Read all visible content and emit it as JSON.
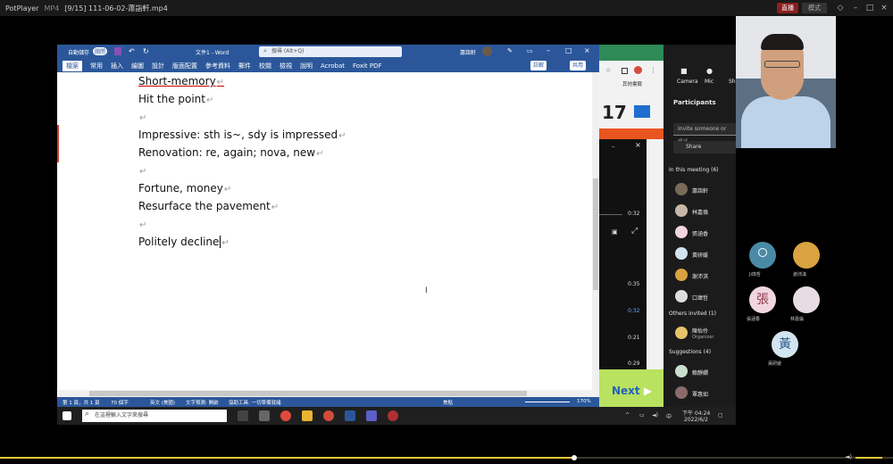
{
  "player": {
    "app_name": "PotPlayer",
    "format": "MP4",
    "file_title": "[9/15] 111-06-02-蕭詣軒.mp4",
    "live_badge": "直播",
    "mode_label": "模式"
  },
  "word": {
    "autosave_label": "自動儲存",
    "autosave_state": "關閉",
    "doc_title": "文件1 - Word",
    "search_placeholder": "搜尋 (Alt+Q)",
    "user_name": "蕭詣軒",
    "tabs": [
      "檔案",
      "常用",
      "插入",
      "繪圖",
      "設計",
      "版面配置",
      "參考資料",
      "郵件",
      "校閱",
      "檢視",
      "說明",
      "Acrobat",
      "Foxit PDF"
    ],
    "comment_btn": "註解",
    "share_btn": "共用",
    "lines": [
      "Short-memory",
      "Hit the point",
      "",
      "Impressive: sth is~, sdy is impressed",
      "Renovation: re, again; nova, new",
      "",
      "Fortune, money",
      "Resurface the pavement",
      "",
      "Politely decline"
    ],
    "status": {
      "page": "第 1 頁，共 1 頁",
      "words": "70 個字",
      "lang": "英文 (美國)",
      "predict": "文字預測: 開啟",
      "accessibility": "協助工具: 一切準備就緒",
      "focus": "焦點",
      "zoom": "170%"
    }
  },
  "taskbar": {
    "search_placeholder": "在這裡輸入文字來搜尋",
    "time": "下午 04:24",
    "date": "2022/6/2"
  },
  "browser": {
    "bookmark": "其他書籤",
    "calendar_number": "17",
    "times": [
      "0:32",
      "0:35",
      "0:32",
      "0:21",
      "0:29"
    ],
    "next_label": "Next"
  },
  "teams": {
    "toolbar": [
      "Camera",
      "Mic",
      "Share"
    ],
    "heading": "Participants",
    "invite_placeholder": "Invite someone or dial",
    "share_label": "Share",
    "in_meeting": "In this meeting (6)",
    "participants": [
      "蕭詣軒",
      "林嘉倫",
      "張涵香",
      "黃研媛",
      "謝沛淇",
      "口瑋哲"
    ],
    "others_invited": "Others invited (1)",
    "organizer_name": "陳怡伶",
    "organizer_role": "Organizer",
    "suggestions": "Suggestions (4)",
    "suggested": [
      "賴靜嫻",
      "覃惠如"
    ]
  },
  "gallery": [
    {
      "name": "Ji瑋哲",
      "initial": "",
      "color": "#4a8aa6"
    },
    {
      "name": "謝沛淇",
      "initial": "",
      "color": "#d9a341"
    },
    {
      "name": "張涵香",
      "initial": "張",
      "color": "#f1d6df"
    },
    {
      "name": "林嘉倫",
      "initial": "",
      "color": "#e7dce3"
    },
    {
      "name": "黃研媛",
      "initial": "黃",
      "color": "#d3e4f1"
    }
  ]
}
